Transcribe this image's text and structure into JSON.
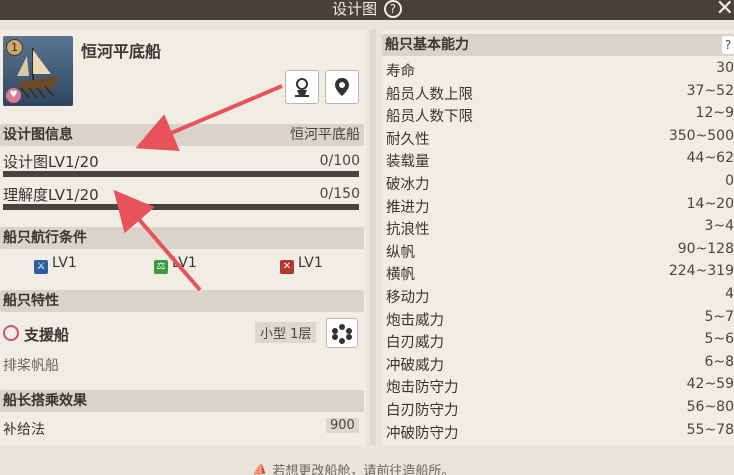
{
  "window": {
    "title": "设计图",
    "help_icon": "?",
    "close_icon": "✕"
  },
  "ship": {
    "name": "恒河平底船",
    "level_badge": "1",
    "heart_icon": "heart-icon"
  },
  "buttons": {
    "customize_icon": "helm-icon",
    "location_icon": "map-pin-icon"
  },
  "blueprint": {
    "header": "设计图信息",
    "header_value": "恒河平底船",
    "design_level_label": "设计图LV1/20",
    "design_level_value": "0/100",
    "design_progress": 0,
    "understanding_label": "理解度LV1/20",
    "understanding_value": "0/150",
    "understanding_progress": 0
  },
  "conditions": {
    "header": "船只航行条件",
    "items": [
      {
        "icon": "sword-icon",
        "label": "LV1",
        "color": "#2f5e9e"
      },
      {
        "icon": "scale-icon",
        "label": "LV1",
        "color": "#3c9a3c"
      },
      {
        "icon": "crossed-swords-icon",
        "label": "LV1",
        "color": "#b5362f"
      }
    ]
  },
  "traits": {
    "header": "船只特性",
    "name": "支援船",
    "size": "小型 1层",
    "type": "排桨帆船",
    "gear_icon": "flower-gear-icon"
  },
  "captain": {
    "header": "船长搭乘效果",
    "label": "补给法",
    "value": "900"
  },
  "stats": {
    "header": "船只基本能力",
    "rows": [
      {
        "label": "寿命",
        "value": "30"
      },
      {
        "label": "船员人数上限",
        "value": "37~52"
      },
      {
        "label": "船员人数下限",
        "value": "12~9"
      },
      {
        "label": "耐久性",
        "value": "350~500"
      },
      {
        "label": "装载量",
        "value": "44~62"
      },
      {
        "label": "破冰力",
        "value": "0"
      },
      {
        "label": "推进力",
        "value": "14~20"
      },
      {
        "label": "抗浪性",
        "value": "3~4"
      },
      {
        "label": "纵帆",
        "value": "90~128"
      },
      {
        "label": "横帆",
        "value": "224~319"
      },
      {
        "label": "移动力",
        "value": "4"
      },
      {
        "label": "炮击威力",
        "value": "5~7"
      },
      {
        "label": "白刃威力",
        "value": "5~6"
      },
      {
        "label": "冲破威力",
        "value": "6~8"
      },
      {
        "label": "炮击防守力",
        "value": "42~59"
      },
      {
        "label": "白刃防守力",
        "value": "56~80"
      },
      {
        "label": "冲破防守力",
        "value": "55~78"
      }
    ]
  },
  "footer": {
    "text": "若想更改船舱，请前往造船所。"
  },
  "colors": {
    "titlebar": "#4a3f39",
    "arrow": "#e8535b",
    "panel": "#f1ede5",
    "header": "#d9d3c9"
  }
}
